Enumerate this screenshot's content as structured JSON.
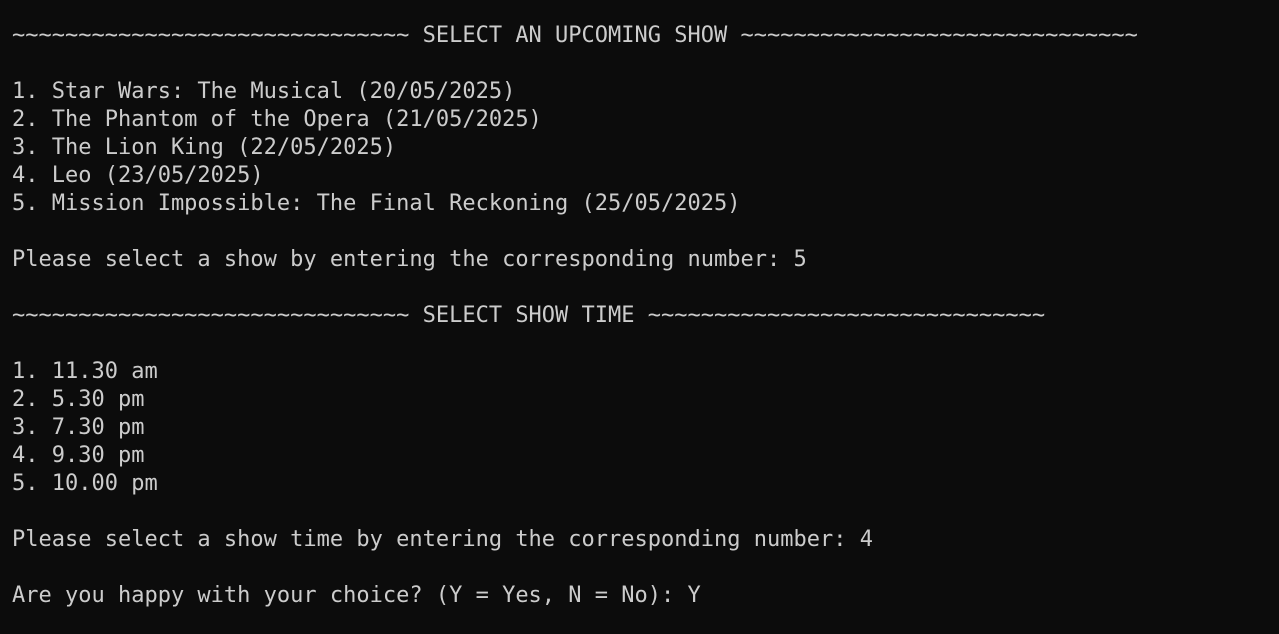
{
  "show_section": {
    "header": "~~~~~~~~~~~~~~~~~~~~~~~~~~~~~~ SELECT AN UPCOMING SHOW ~~~~~~~~~~~~~~~~~~~~~~~~~~~~~~",
    "options": [
      "1. Star Wars: The Musical (20/05/2025)",
      "2. The Phantom of the Opera (21/05/2025)",
      "3. The Lion King (22/05/2025)",
      "4. Leo (23/05/2025)",
      "5. Mission Impossible: The Final Reckoning (25/05/2025)"
    ],
    "prompt": "Please select a show by entering the corresponding number: ",
    "answer": "5"
  },
  "time_section": {
    "header": "~~~~~~~~~~~~~~~~~~~~~~~~~~~~~~ SELECT SHOW TIME ~~~~~~~~~~~~~~~~~~~~~~~~~~~~~~",
    "options": [
      "1. 11.30 am",
      "2. 5.30 pm",
      "3. 7.30 pm",
      "4. 9.30 pm",
      "5. 10.00 pm"
    ],
    "prompt": "Please select a show time by entering the corresponding number: ",
    "answer": "4"
  },
  "confirm": {
    "prompt": "Are you happy with your choice? (Y = Yes, N = No): ",
    "answer": "Y"
  },
  "colors": {
    "background": "#0c0c0c",
    "text": "#cccccc"
  }
}
